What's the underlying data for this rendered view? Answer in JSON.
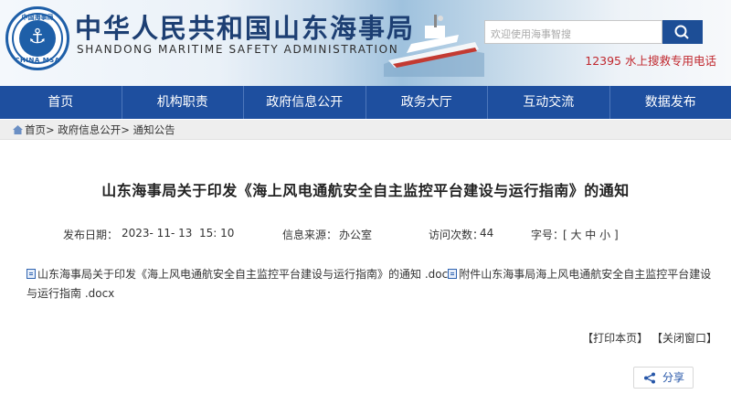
{
  "header": {
    "logo_text_top": "中国海事局",
    "logo_text_bottom": "CHINA MSA",
    "title": "中华人民共和国山东海事局",
    "subtitle": "SHANDONG MARITIME SAFETY ADMINISTRATION",
    "search_placeholder": "欢迎使用海事智搜",
    "hotline": "12395 水上搜救专用电话"
  },
  "nav": [
    "首页",
    "机构职责",
    "政府信息公开",
    "政务大厅",
    "互动交流",
    "数据发布"
  ],
  "breadcrumb": {
    "home": "首页",
    "sep": ">",
    "level1": "政府信息公开",
    "level2": "通知公告"
  },
  "article": {
    "title": "山东海事局关于印发《海上风电通航安全自主监控平台建设与运行指南》的通知",
    "publish_label": "发布日期：",
    "publish_date": "2023- 11- 13  15: 10",
    "source_label": "信息来源：",
    "source": "办公室",
    "visits_label": "访问次数：",
    "visits": "44",
    "fontsize_label": "字号：",
    "fontsize_options": "[ 大 中 小 ]",
    "attachments": [
      "山东海事局关于印发《海上风电通航安全自主监控平台建设与运行指南》的通知 .doc",
      "附件山东海事局海上风电通航安全自主监控平台建设与运行指南 .docx"
    ]
  },
  "actions": {
    "print": "【打印本页】",
    "close": "【关闭窗口】",
    "share": "分享"
  },
  "colors": {
    "nav_bg": "#1e4f9f",
    "title_blue": "#1d3f73",
    "hotline_red": "#c0272d"
  }
}
